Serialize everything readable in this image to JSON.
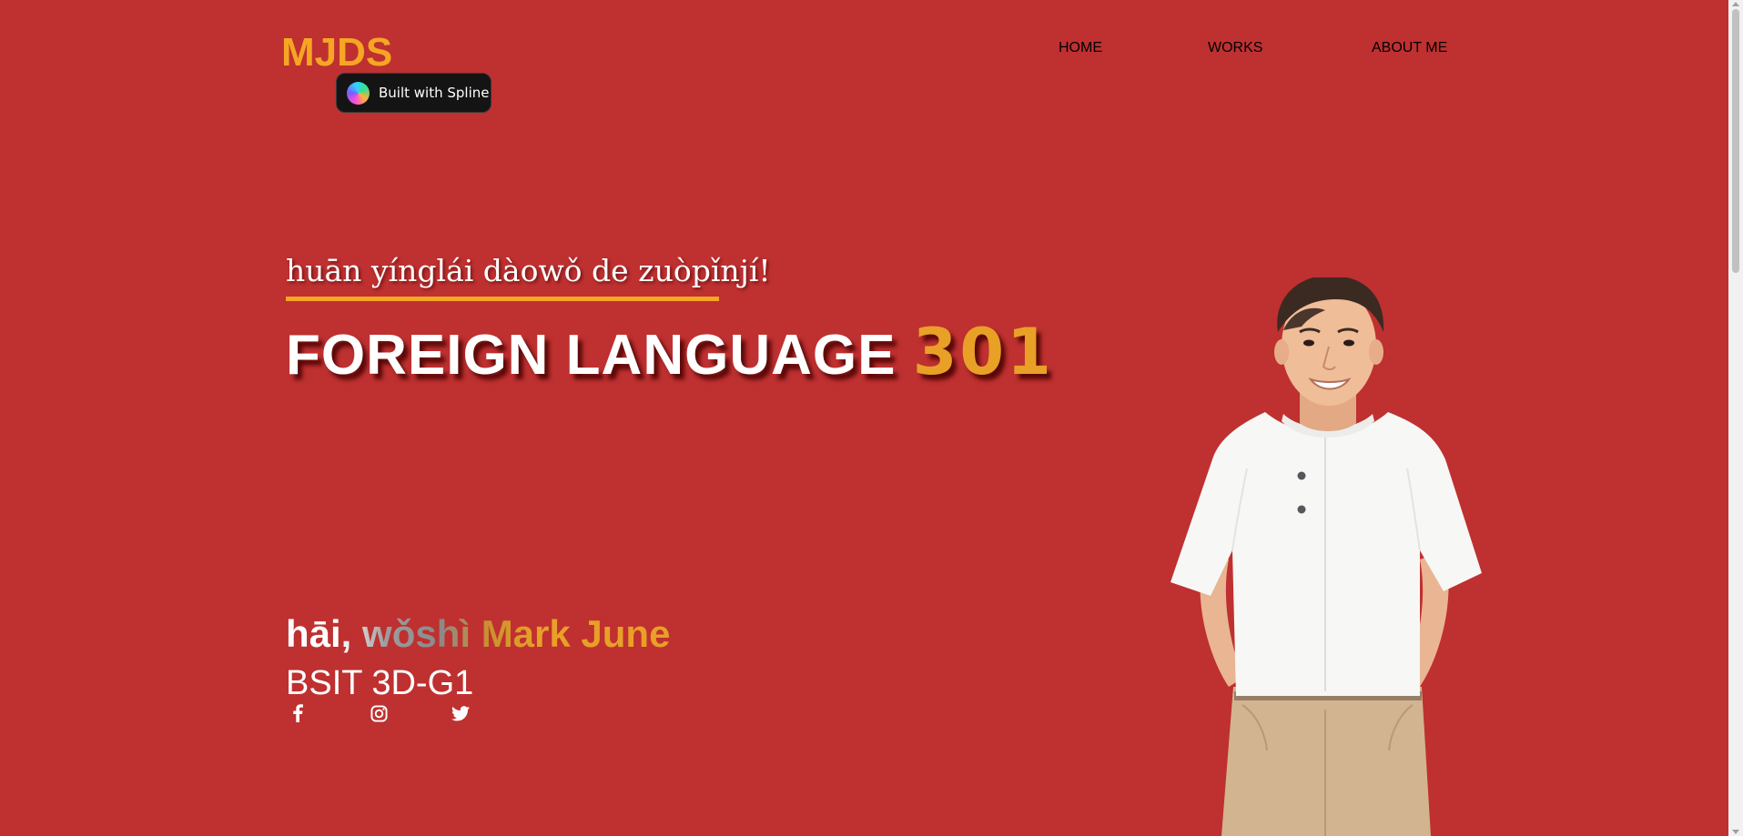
{
  "header": {
    "logo": "MJDS",
    "spline_badge": "Built with Spline",
    "nav": {
      "home": "HOME",
      "works": "WORKS",
      "about": "ABOUT ME"
    }
  },
  "hero": {
    "greeting": "huān yínglái dàowǒ de zuòpǐnjí!",
    "title_main": "FOREIGN LANGUAGE",
    "title_number": "301",
    "intro": "hāi, wǒshì Mark June",
    "section": "BSIT 3D-G1"
  },
  "socials": [
    {
      "icon": "facebook-icon"
    },
    {
      "icon": "instagram-icon"
    },
    {
      "icon": "twitter-icon"
    }
  ],
  "colors": {
    "background": "#bf3030",
    "accent": "#f5a623",
    "text": "#ffffff"
  }
}
